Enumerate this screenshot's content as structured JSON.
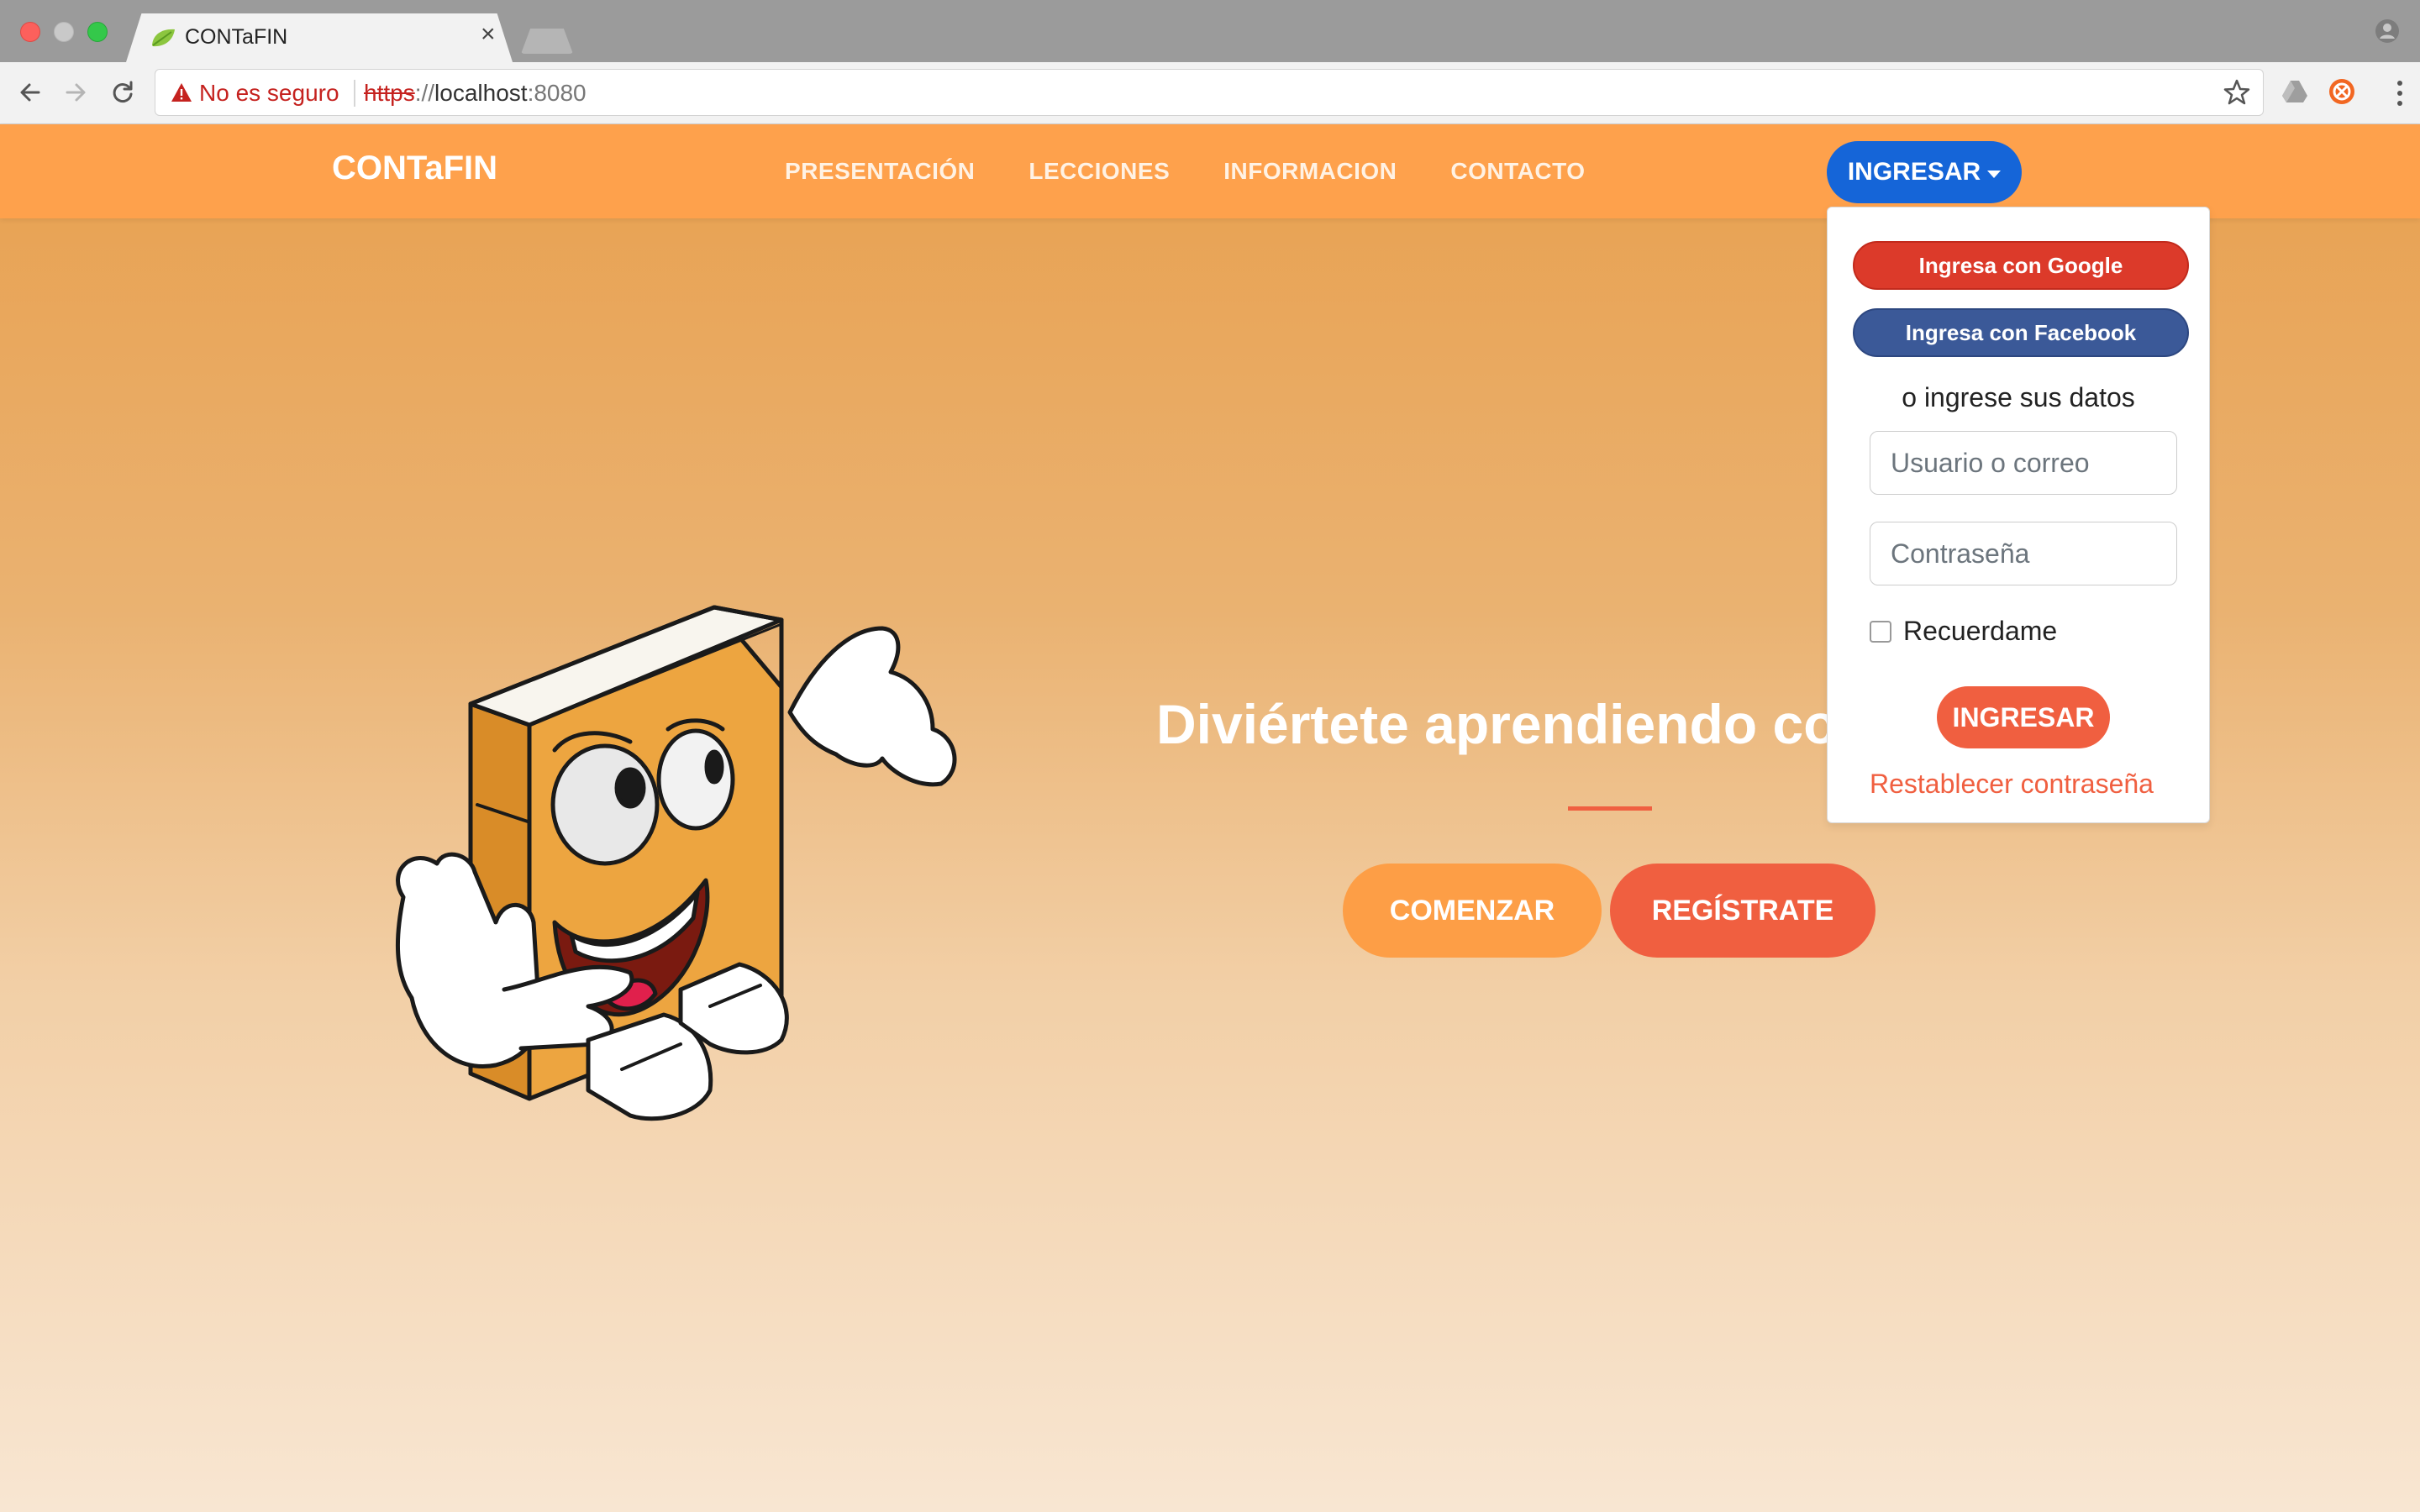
{
  "browser": {
    "tab_title": "CONTaFIN",
    "security_label": "No es seguro",
    "url_scheme": "https",
    "url_separator": "://",
    "url_host": "localhost",
    "url_port": ":8080"
  },
  "navbar": {
    "brand": "CONTaFIN",
    "links": [
      "PRESENTACIÓN",
      "LECCIONES",
      "INFORMACION",
      "CONTACTO"
    ],
    "login_toggle": "INGRESAR"
  },
  "hero": {
    "title": "Diviértete aprendiendo con",
    "start_button": "COMENZAR",
    "register_button": "REGÍSTRATE"
  },
  "login_dropdown": {
    "google_button": "Ingresa con Google",
    "facebook_button": "Ingresa con Facebook",
    "or_text": "o ingrese sus datos",
    "username_placeholder": "Usuario o correo",
    "password_placeholder": "Contraseña",
    "remember_label": "Recuerdame",
    "submit_button": "INGRESAR",
    "reset_link": "Restablecer contraseña"
  },
  "colors": {
    "navbar": "#fea14c",
    "primary_blue": "#1565d8",
    "accent_red": "#f05f40",
    "google_red": "#dc3a2a",
    "facebook_blue": "#3b5998"
  },
  "icons": {
    "tab_favicon": "leaf-icon",
    "close": "close-icon",
    "back": "back-arrow-icon",
    "forward": "forward-arrow-icon",
    "reload": "reload-icon",
    "warning": "warning-icon",
    "bookmark": "star-icon",
    "profile": "profile-icon",
    "menu": "kebab-menu-icon"
  }
}
